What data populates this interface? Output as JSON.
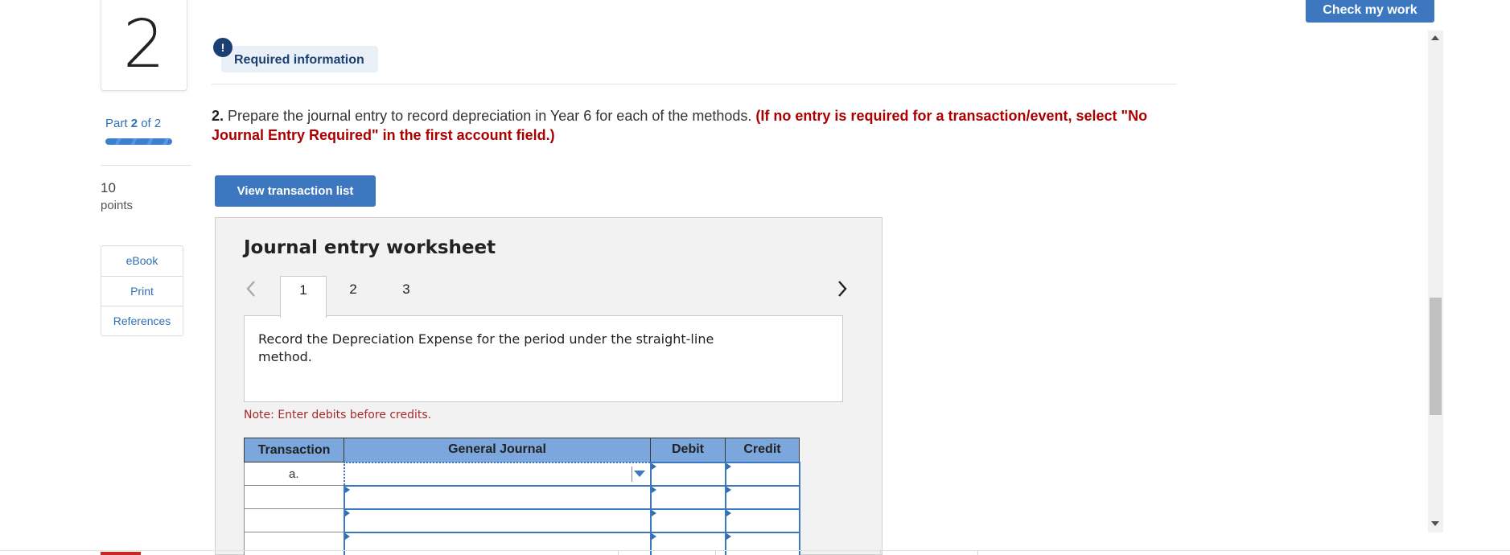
{
  "question": {
    "number": "2",
    "part_prefix": "Part",
    "part_current": "2",
    "part_suffix": "of 2",
    "points_value": "10",
    "points_label": "points"
  },
  "side_links": [
    {
      "label": "eBook"
    },
    {
      "label": "Print"
    },
    {
      "label": "References"
    }
  ],
  "header": {
    "check_button": "Check my work"
  },
  "required": {
    "icon": "!",
    "label": "Required information"
  },
  "prompt": {
    "number": "2.",
    "text": " Prepare the journal entry to record depreciation in Year 6 for each of the methods. ",
    "instruction": "(If no entry is required for a transaction/event, select \"No Journal Entry Required\" in the first account field.)"
  },
  "view_button": "View transaction list",
  "worksheet": {
    "title": "Journal entry worksheet",
    "tabs": [
      "1",
      "2",
      "3"
    ],
    "active_tab": "1",
    "description": "Record the Depreciation Expense for the period under the straight-line method.",
    "note": "Note: Enter debits before credits.",
    "table": {
      "headers": [
        "Transaction",
        "General Journal",
        "Debit",
        "Credit"
      ],
      "rows": [
        {
          "transaction": "a.",
          "account": "",
          "debit": "",
          "credit": ""
        },
        {
          "transaction": "",
          "account": "",
          "debit": "",
          "credit": ""
        },
        {
          "transaction": "",
          "account": "",
          "debit": "",
          "credit": ""
        }
      ]
    }
  },
  "colors": {
    "accent": "#3d77c0",
    "required_red": "#aa0000",
    "table_header": "#7ba7dd"
  }
}
